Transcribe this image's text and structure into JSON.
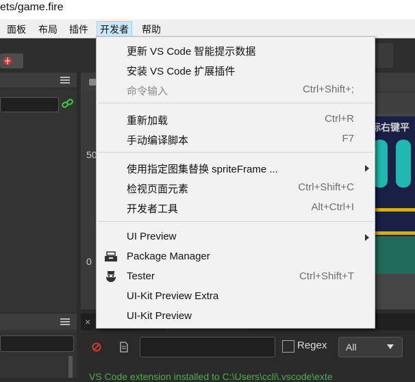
{
  "window": {
    "title": "ets/game.fire"
  },
  "menubar": {
    "items": [
      "面板",
      "布局",
      "插件",
      "开发者",
      "帮助"
    ],
    "active_index": 3
  },
  "scene": {
    "axis_label_50": "50",
    "axis_label_0": "0",
    "overlay_text": "标右键平"
  },
  "console": {
    "regex_label": "Regex",
    "filter_select": "All",
    "log_line": "VS Code extension installed to C:\\Users\\ccli\\.vscode\\exte"
  },
  "dev_menu": {
    "items": [
      {
        "label": "更新 VS Code 智能提示数据",
        "accel": "",
        "submenu": false,
        "disabled": false,
        "icon": ""
      },
      {
        "label": "安装 VS Code 扩展插件",
        "accel": "",
        "submenu": false,
        "disabled": false,
        "icon": ""
      },
      {
        "label": "命令输入",
        "accel": "Ctrl+Shift+;",
        "submenu": false,
        "disabled": true,
        "icon": ""
      },
      {
        "label": "重新加载",
        "accel": "Ctrl+R",
        "submenu": false,
        "disabled": false,
        "icon": ""
      },
      {
        "label": "手动编译脚本",
        "accel": "F7",
        "submenu": false,
        "disabled": false,
        "icon": ""
      },
      {
        "label": "使用指定图集替换 spriteFrame ...",
        "accel": "",
        "submenu": true,
        "disabled": false,
        "icon": ""
      },
      {
        "label": "检视页面元素",
        "accel": "Ctrl+Shift+C",
        "submenu": false,
        "disabled": false,
        "icon": ""
      },
      {
        "label": "开发者工具",
        "accel": "Alt+Ctrl+I",
        "submenu": false,
        "disabled": false,
        "icon": ""
      },
      {
        "label": "UI Preview",
        "accel": "",
        "submenu": true,
        "disabled": false,
        "icon": ""
      },
      {
        "label": "Package Manager",
        "accel": "",
        "submenu": false,
        "disabled": false,
        "icon": "package-icon"
      },
      {
        "label": "Tester",
        "accel": "Ctrl+Shift+T",
        "submenu": false,
        "disabled": false,
        "icon": "tester-icon"
      },
      {
        "label": "UI-Kit Preview Extra",
        "accel": "",
        "submenu": false,
        "disabled": false,
        "icon": ""
      },
      {
        "label": "UI-Kit Preview",
        "accel": "",
        "submenu": false,
        "disabled": false,
        "icon": ""
      }
    ]
  },
  "colors": {
    "menu_bg": "#f2f2f2",
    "menu_active_bg": "#cce8ff",
    "editor_bg": "#2b2b2b",
    "link_green": "#39d13a",
    "log_green": "#4caf50",
    "error_red": "#d9362b"
  }
}
